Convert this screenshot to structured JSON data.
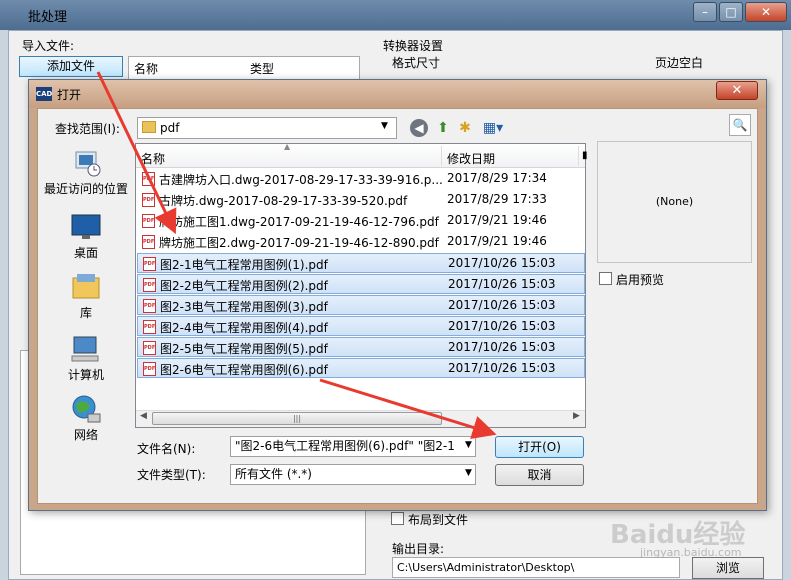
{
  "background_window": {
    "title": "批处理",
    "import_label": "导入文件:",
    "add_file_button": "添加文件",
    "list_columns": [
      "名称",
      "类型"
    ],
    "converter_label": "转换器设置",
    "format_size_label": "格式尺寸",
    "margin_label": "页边空白",
    "layout_to_file_label": "布局到文件",
    "output_dir_label": "输出目录:",
    "output_dir_value": "C:\\Users\\Administrator\\Desktop\\",
    "browse_button": "浏览"
  },
  "dialog": {
    "title": "打开",
    "icon_text": "CAD",
    "close_symbol": "✕",
    "look_in_label": "查找范围(I):",
    "look_in_value": "pdf",
    "places": [
      {
        "label": "最近访问的位置",
        "icon": "recent-places-icon"
      },
      {
        "label": "桌面",
        "icon": "desktop-icon"
      },
      {
        "label": "库",
        "icon": "library-icon"
      },
      {
        "label": "计算机",
        "icon": "computer-icon"
      },
      {
        "label": "网络",
        "icon": "network-icon"
      }
    ],
    "columns": {
      "name": "名称",
      "date": "修改日期"
    },
    "files": [
      {
        "name": "古建牌坊入口.dwg-2017-08-29-17-33-39-916.p...",
        "date": "2017/8/29 17:34",
        "selected": false
      },
      {
        "name": "古牌坊.dwg-2017-08-29-17-33-39-520.pdf",
        "date": "2017/8/29 17:33",
        "selected": false
      },
      {
        "name": "牌坊施工图1.dwg-2017-09-21-19-46-12-796.pdf",
        "date": "2017/9/21 19:46",
        "selected": false
      },
      {
        "name": "牌坊施工图2.dwg-2017-09-21-19-46-12-890.pdf",
        "date": "2017/9/21 19:46",
        "selected": false
      },
      {
        "name": "图2-1电气工程常用图例(1).pdf",
        "date": "2017/10/26 15:03",
        "selected": true
      },
      {
        "name": "图2-2电气工程常用图例(2).pdf",
        "date": "2017/10/26 15:03",
        "selected": true
      },
      {
        "name": "图2-3电气工程常用图例(3).pdf",
        "date": "2017/10/26 15:03",
        "selected": true
      },
      {
        "name": "图2-4电气工程常用图例(4).pdf",
        "date": "2017/10/26 15:03",
        "selected": true
      },
      {
        "name": "图2-5电气工程常用图例(5).pdf",
        "date": "2017/10/26 15:03",
        "selected": true
      },
      {
        "name": "图2-6电气工程常用图例(6).pdf",
        "date": "2017/10/26 15:03",
        "selected": true
      }
    ],
    "preview_text": "(None)",
    "enable_preview_label": "启用预览",
    "file_name_label": "文件名(N):",
    "file_name_value": "\"图2-6电气工程常用图例(6).pdf\" \"图2-1",
    "file_type_label": "文件类型(T):",
    "file_type_value": "所有文件 (*.*)",
    "open_button": "打开(O)",
    "cancel_button": "取消"
  },
  "watermark": {
    "text": "Baidu经验",
    "sub": "jingyan.baidu.com"
  },
  "colors": {
    "arrow": "#e83a2f",
    "selection": "#cfe2f7"
  }
}
